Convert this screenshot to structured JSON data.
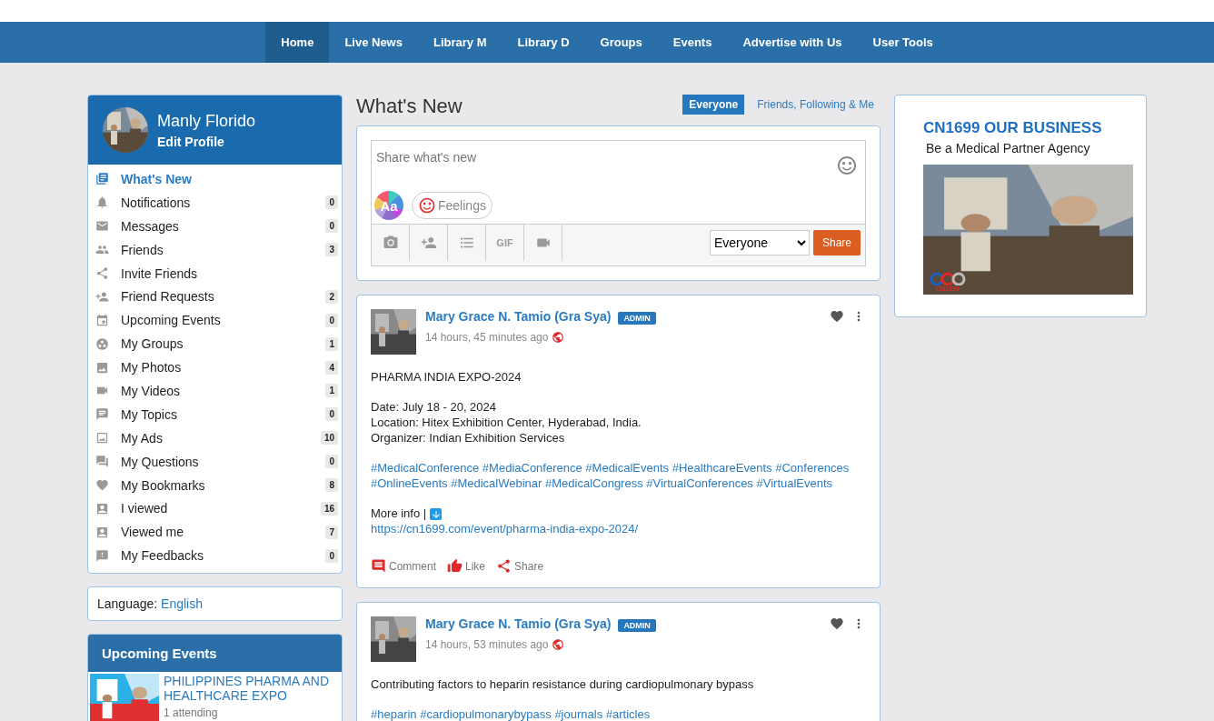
{
  "nav": [
    {
      "label": "Home",
      "selected": true
    },
    {
      "label": "Live News",
      "selected": false
    },
    {
      "label": "Library M",
      "selected": false
    },
    {
      "label": "Library D",
      "selected": false
    },
    {
      "label": "Groups",
      "selected": false
    },
    {
      "label": "Events",
      "selected": false
    },
    {
      "label": "Advertise with Us",
      "selected": false
    },
    {
      "label": "User Tools",
      "selected": false
    }
  ],
  "profile": {
    "name": "Manly Florido",
    "edit_label": "Edit Profile"
  },
  "menu": [
    {
      "label": "What's New",
      "selected": true
    },
    {
      "label": "Notifications",
      "selected": false,
      "count": "0"
    },
    {
      "label": "Messages",
      "selected": false,
      "count": "0"
    },
    {
      "label": "Friends",
      "selected": false,
      "count": "3"
    },
    {
      "label": "Invite Friends",
      "selected": false
    },
    {
      "label": "Friend Requests",
      "selected": false,
      "count": "2"
    },
    {
      "label": "Upcoming Events",
      "selected": false,
      "count": "0"
    },
    {
      "label": "My Groups",
      "selected": false,
      "count": "1"
    },
    {
      "label": "My Photos",
      "selected": false,
      "count": "4"
    },
    {
      "label": "My Videos",
      "selected": false,
      "count": "1"
    },
    {
      "label": "My Topics",
      "selected": false,
      "count": "0"
    },
    {
      "label": "My Ads",
      "selected": false,
      "count": "10"
    },
    {
      "label": "My Questions",
      "selected": false,
      "count": "0"
    },
    {
      "label": "My Bookmarks",
      "selected": false,
      "count": "8"
    },
    {
      "label": "I viewed",
      "selected": false,
      "count": "16"
    },
    {
      "label": "Viewed me",
      "selected": false,
      "count": "7"
    },
    {
      "label": "My Feedbacks",
      "selected": false,
      "count": "0"
    }
  ],
  "language": {
    "label": "Language:",
    "value": "English"
  },
  "upcoming_events": {
    "title": "Upcoming Events",
    "items": [
      {
        "title": "PHILIPPINES PHARMA AND HEALTHCARE EXPO",
        "attending": "1 attending"
      }
    ]
  },
  "feed": {
    "title": "What's New",
    "filters": [
      {
        "label": "Everyone",
        "selected": true
      },
      {
        "label": "Friends, Following & Me",
        "selected": false
      }
    ]
  },
  "composer": {
    "placeholder": "Share what's new",
    "font_button": "Aa",
    "feelings": "Feelings",
    "tools": [
      {
        "kind": "camera"
      },
      {
        "kind": "tag"
      },
      {
        "kind": "list"
      },
      {
        "kind": "gif",
        "label": "GIF"
      },
      {
        "kind": "video"
      }
    ],
    "privacy": "Everyone",
    "share": "Share"
  },
  "posts": [
    {
      "author": "Mary Grace N. Tamio (Gra Sya)",
      "badge": "ADMIN",
      "time": "14 hours, 45 minutes ago",
      "paragraphs": [
        {
          "kind": "text",
          "lines": [
            "PHARMA INDIA EXPO-2024"
          ]
        },
        {
          "kind": "text",
          "lines": [
            "Date: July 18 - 20, 2024",
            "Location: Hitex Exhibition Center, Hyderabad, India.",
            "Organizer: Indian Exhibition Services"
          ]
        },
        {
          "kind": "tags",
          "tags": [
            "#MedicalConference",
            "#MediaConference",
            "#MedicalEvents",
            "#HealthcareEvents",
            "#Conferences",
            "#OnlineEvents",
            "#MedicalWebinar",
            "#MedicalCongress",
            "#VirtualConferences",
            "#VirtualEvents"
          ]
        },
        {
          "kind": "more",
          "label": "More info |",
          "url": "https://cn1699.com/event/pharma-india-expo-2024/"
        }
      ],
      "actions": [
        "Comment",
        "Like",
        "Share"
      ]
    },
    {
      "author": "Mary Grace N. Tamio (Gra Sya)",
      "badge": "ADMIN",
      "time": "14 hours, 53 minutes ago",
      "paragraphs": [
        {
          "kind": "text",
          "lines": [
            "Contributing factors to heparin resistance during cardiopulmonary bypass"
          ]
        },
        {
          "kind": "tags",
          "tags": [
            "#heparin",
            "#cardiopulmonarybypass",
            "#journals",
            "#articles"
          ]
        }
      ]
    }
  ],
  "ad": {
    "headline": "CN1699 OUR BUSINESS",
    "subtitle": "Be a Medical Partner Agency",
    "logo_text": "CN1699"
  }
}
